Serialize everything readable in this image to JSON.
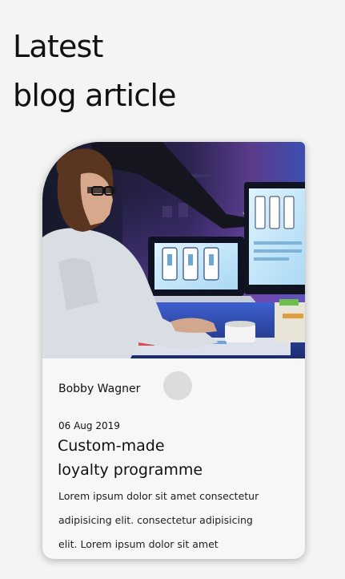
{
  "section": {
    "heading_line1": "Latest",
    "heading_line2": "blog article"
  },
  "article": {
    "image_description": "woman-working-at-computer-photo",
    "author": "Bobby Wagner",
    "date": "06 Aug 2019",
    "title_line1": "Custom-made",
    "title_line2": "loyalty programme",
    "excerpt_line1": "Lorem ipsum dolor sit amet consectetur",
    "excerpt_line2": "adipisicing elit. consectetur adipisicing",
    "excerpt_line3": "elit. Lorem ipsum dolor sit amet"
  },
  "colors": {
    "background": "#f4f4f4",
    "card": "#f7f7f7",
    "text": "#111111",
    "avatar_placeholder": "#dcdcdc"
  }
}
